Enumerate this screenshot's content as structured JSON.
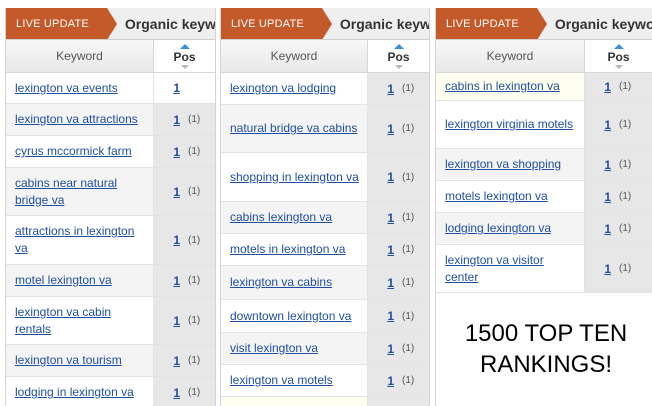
{
  "header": {
    "badge": "LIVE UPDATE",
    "title": "Organic keywords"
  },
  "columns": {
    "keyword": "Keyword",
    "pos": "Pos"
  },
  "panels": [
    {
      "rows": [
        {
          "keyword": "lexington va events",
          "pos": "1",
          "change": ""
        },
        {
          "keyword": "lexington va attractions",
          "pos": "1",
          "change": "(1)"
        },
        {
          "keyword": "cyrus mccormick farm",
          "pos": "1",
          "change": "(1)"
        },
        {
          "keyword": "cabins near natural bridge va",
          "pos": "1",
          "change": "(1)"
        },
        {
          "keyword": "attractions in lexington va",
          "pos": "1",
          "change": "(1)"
        },
        {
          "keyword": "motel lexington va",
          "pos": "1",
          "change": "(1)"
        },
        {
          "keyword": "lexington va cabin rentals",
          "pos": "1",
          "change": "(1)"
        },
        {
          "keyword": "lexington va tourism",
          "pos": "1",
          "change": "(1)"
        },
        {
          "keyword": "lodging in lexington va",
          "pos": "1",
          "change": "(1)"
        }
      ]
    },
    {
      "rows": [
        {
          "keyword": "lexington va lodging",
          "pos": "1",
          "change": "(1)"
        },
        {
          "keyword": "natural bridge va cabins",
          "pos": "1",
          "change": "(1)"
        },
        {
          "keyword": "shopping in lexington va",
          "pos": "1",
          "change": "(1)"
        },
        {
          "keyword": "cabins lexington va",
          "pos": "1",
          "change": "(1)"
        },
        {
          "keyword": "motels in lexington va",
          "pos": "1",
          "change": "(1)"
        },
        {
          "keyword": "lexington va cabins",
          "pos": "1",
          "change": "(1)"
        },
        {
          "keyword": "downtown lexington va",
          "pos": "1",
          "change": "(1)"
        },
        {
          "keyword": "visit lexington va",
          "pos": "1",
          "change": "(1)"
        },
        {
          "keyword": "lexington va motels",
          "pos": "1",
          "change": "(1)"
        }
      ]
    },
    {
      "rows": [
        {
          "keyword": "cabins in lexington va",
          "pos": "1",
          "change": "(1)"
        },
        {
          "keyword": "lexington virginia motels",
          "pos": "1",
          "change": "(1)"
        },
        {
          "keyword": "lexington va shopping",
          "pos": "1",
          "change": "(1)"
        },
        {
          "keyword": "motels lexington va",
          "pos": "1",
          "change": "(1)"
        },
        {
          "keyword": "lodging lexington va",
          "pos": "1",
          "change": "(1)"
        },
        {
          "keyword": "lexington va visitor center",
          "pos": "1",
          "change": "(1)"
        }
      ]
    }
  ],
  "callout": {
    "line1": "1500 TOP TEN",
    "line2": "RANKINGS!"
  }
}
